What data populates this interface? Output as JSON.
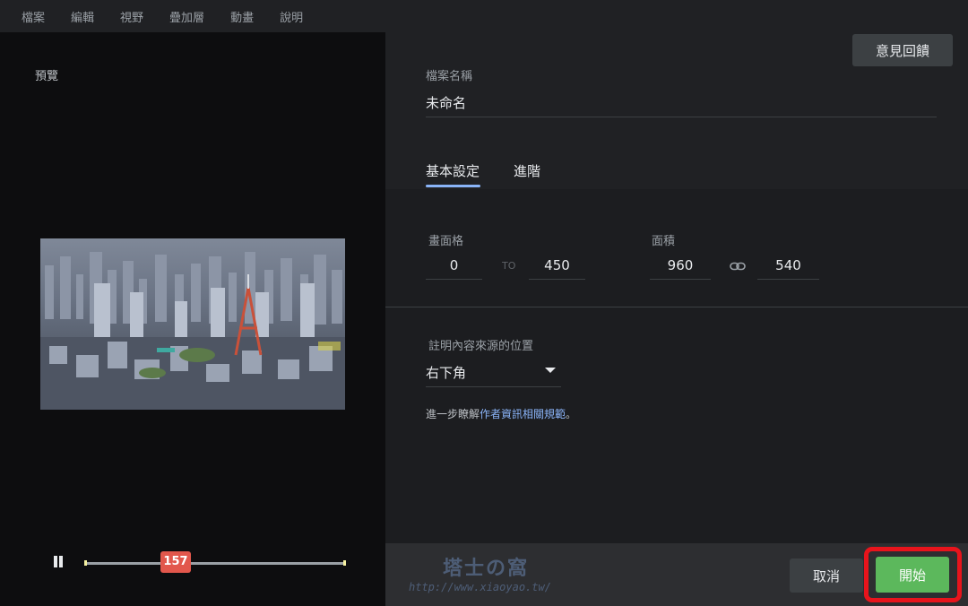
{
  "menu": {
    "items": [
      "檔案",
      "編輯",
      "視野",
      "疊加層",
      "動畫",
      "說明"
    ]
  },
  "preview": {
    "label": "預覽",
    "playhead_frame": "157",
    "playhead_fraction": 0.37,
    "pause_icon": "pause-icon"
  },
  "feedback": {
    "label": "意見回饋"
  },
  "file": {
    "label": "檔案名稱",
    "value": "未命名"
  },
  "tabs": {
    "basic": "基本設定",
    "advanced": "進階",
    "active": "basic"
  },
  "frames": {
    "label": "畫面格",
    "start": "0",
    "to_label": "TO",
    "end": "450"
  },
  "area": {
    "label": "面積",
    "width": "960",
    "height": "540",
    "link_icon": "link-icon"
  },
  "attribution": {
    "label": "註明內容來源的位置",
    "selected": "右下角"
  },
  "learn_more": {
    "prefix": "進一步瞭解",
    "link": "作者資訊相關規範",
    "suffix": "。"
  },
  "actions": {
    "cancel": "取消",
    "start": "開始"
  },
  "watermark": {
    "title": "塔士の窩",
    "url": "http://www.xiaoyao.tw/"
  },
  "colors": {
    "accent_blue": "#8ab4f8",
    "start_green": "#5cb85c",
    "highlight_red": "#e8141c",
    "playhead_red": "#e2574c"
  }
}
